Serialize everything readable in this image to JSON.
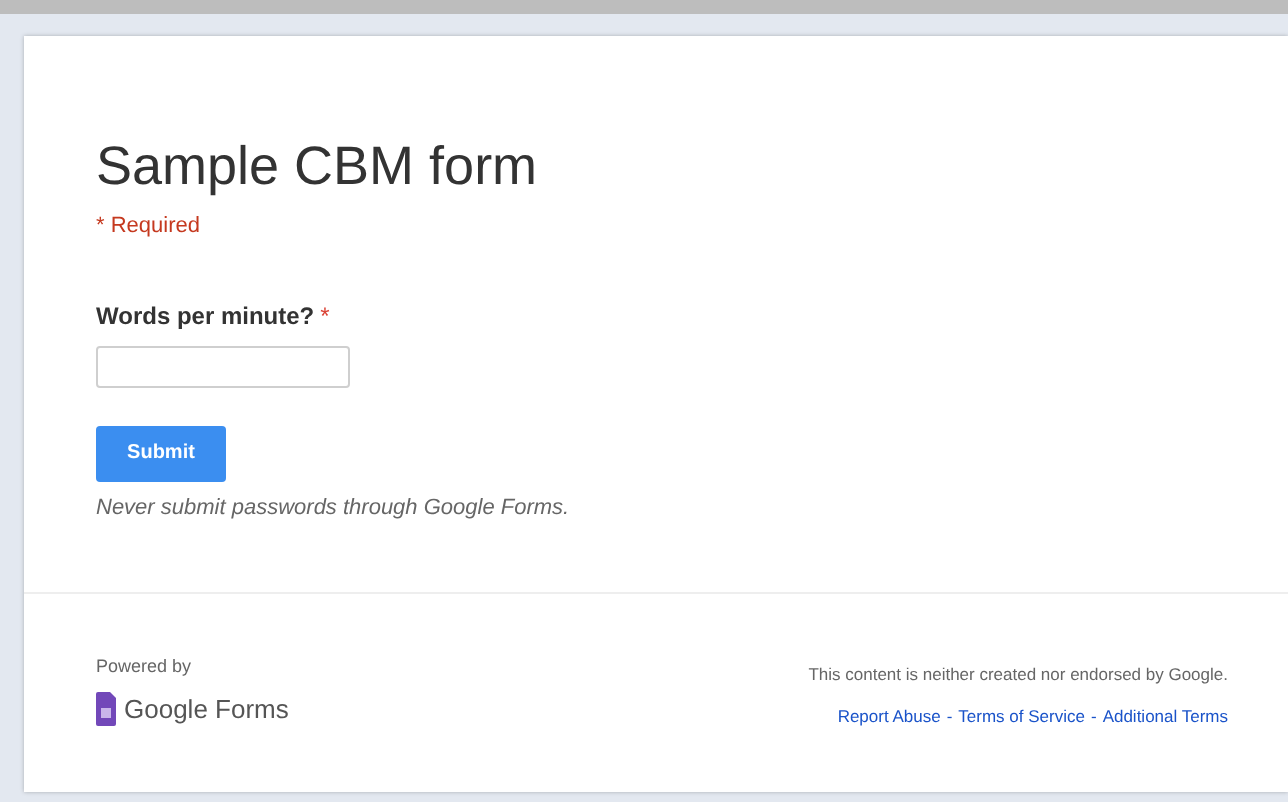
{
  "form": {
    "title": "Sample CBM form",
    "required_note": "* Required",
    "question": {
      "label": "Words per minute?",
      "required_mark": "*"
    },
    "submit": "Submit",
    "warning": "Never submit passwords through Google Forms."
  },
  "footer": {
    "powered_by": "Powered by",
    "brand": "Google Forms",
    "disclaimer": "This content is neither created nor endorsed by Google.",
    "separator": "-",
    "links": [
      "Report Abuse",
      "Terms of Service",
      "Additional Terms"
    ]
  }
}
